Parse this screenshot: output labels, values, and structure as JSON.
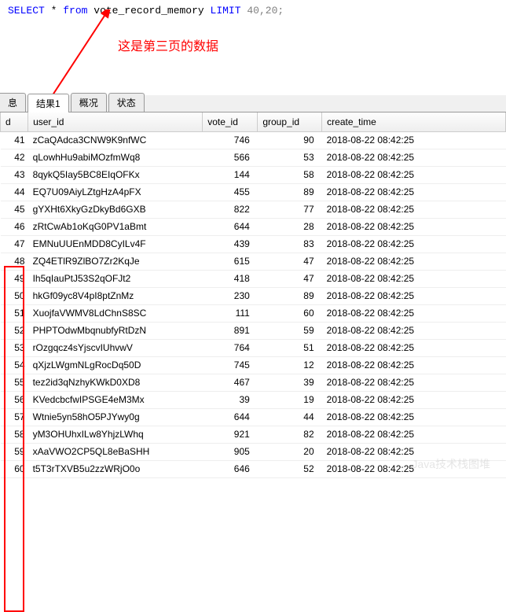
{
  "sql": {
    "select": "SELECT",
    "star": "*",
    "from": "from",
    "table": "vote_record_memory",
    "limit": "LIMIT",
    "args": "40,20;"
  },
  "annotation": "这是第三页的数据",
  "tabs": {
    "t0": "息",
    "t1": "结果1",
    "t2": "概况",
    "t3": "状态"
  },
  "headers": {
    "d": "d",
    "user_id": "user_id",
    "vote_id": "vote_id",
    "group_id": "group_id",
    "create_time": "create_time"
  },
  "rows": [
    {
      "d": "41",
      "user_id": "zCaQAdca3CNW9K9nfWC",
      "vote_id": "746",
      "group_id": "90",
      "create_time": "2018-08-22 08:42:25"
    },
    {
      "d": "42",
      "user_id": "qLowhHu9abiMOzfmWq8",
      "vote_id": "566",
      "group_id": "53",
      "create_time": "2018-08-22 08:42:25"
    },
    {
      "d": "43",
      "user_id": "8qykQ5Iay5BC8EIqOFKx",
      "vote_id": "144",
      "group_id": "58",
      "create_time": "2018-08-22 08:42:25"
    },
    {
      "d": "44",
      "user_id": "EQ7U09AiyLZtgHzA4pFX",
      "vote_id": "455",
      "group_id": "89",
      "create_time": "2018-08-22 08:42:25"
    },
    {
      "d": "45",
      "user_id": "gYXHt6XkyGzDkyBd6GXB",
      "vote_id": "822",
      "group_id": "77",
      "create_time": "2018-08-22 08:42:25"
    },
    {
      "d": "46",
      "user_id": "zRtCwAb1oKqG0PV1aBmt",
      "vote_id": "644",
      "group_id": "28",
      "create_time": "2018-08-22 08:42:25"
    },
    {
      "d": "47",
      "user_id": "EMNuUUEnMDD8CyILv4F",
      "vote_id": "439",
      "group_id": "83",
      "create_time": "2018-08-22 08:42:25"
    },
    {
      "d": "48",
      "user_id": "ZQ4ETlR9ZlBO7Zr2KqJe",
      "vote_id": "615",
      "group_id": "47",
      "create_time": "2018-08-22 08:42:25"
    },
    {
      "d": "49",
      "user_id": "Ih5qIauPtJ53S2qOFJt2",
      "vote_id": "418",
      "group_id": "47",
      "create_time": "2018-08-22 08:42:25"
    },
    {
      "d": "50",
      "user_id": "hkGf09yc8V4pI8ptZnMz",
      "vote_id": "230",
      "group_id": "89",
      "create_time": "2018-08-22 08:42:25"
    },
    {
      "d": "51",
      "user_id": "XuojfaVWMV8LdChnS8SC",
      "vote_id": "111",
      "group_id": "60",
      "create_time": "2018-08-22 08:42:25"
    },
    {
      "d": "52",
      "user_id": "PHPTOdwMbqnubfyRtDzN",
      "vote_id": "891",
      "group_id": "59",
      "create_time": "2018-08-22 08:42:25"
    },
    {
      "d": "53",
      "user_id": "rOzgqcz4sYjscvIUhvwV",
      "vote_id": "764",
      "group_id": "51",
      "create_time": "2018-08-22 08:42:25"
    },
    {
      "d": "54",
      "user_id": "qXjzLWgmNLgRocDq50D",
      "vote_id": "745",
      "group_id": "12",
      "create_time": "2018-08-22 08:42:25"
    },
    {
      "d": "55",
      "user_id": "tez2id3qNzhyKWkD0XD8",
      "vote_id": "467",
      "group_id": "39",
      "create_time": "2018-08-22 08:42:25"
    },
    {
      "d": "56",
      "user_id": "KVedcbcfwIPSGE4eM3Mx",
      "vote_id": "39",
      "group_id": "19",
      "create_time": "2018-08-22 08:42:25"
    },
    {
      "d": "57",
      "user_id": "Wtnie5yn58hO5PJYwy0g",
      "vote_id": "644",
      "group_id": "44",
      "create_time": "2018-08-22 08:42:25"
    },
    {
      "d": "58",
      "user_id": "yM3OHUhxILw8YhjzLWhq",
      "vote_id": "921",
      "group_id": "82",
      "create_time": "2018-08-22 08:42:25"
    },
    {
      "d": "59",
      "user_id": "xAaVWO2CP5QL8eBaSHH",
      "vote_id": "905",
      "group_id": "20",
      "create_time": "2018-08-22 08:42:25"
    },
    {
      "d": "60",
      "user_id": "t5T3rTXVB5u2zzWRjO0o",
      "vote_id": "646",
      "group_id": "52",
      "create_time": "2018-08-22 08:42:25"
    }
  ],
  "watermark": "Java技术栈图堆"
}
